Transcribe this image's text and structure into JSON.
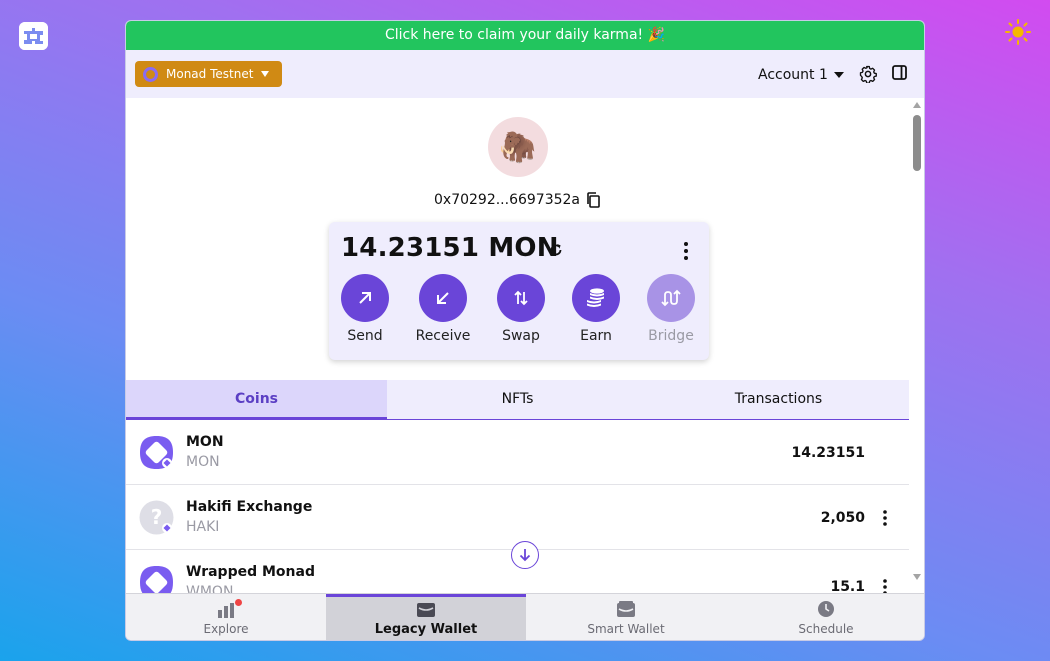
{
  "banner": {
    "text": "Click here to claim your daily karma! 🎉"
  },
  "topbar": {
    "network": "Monad Testnet",
    "account": "Account 1"
  },
  "profile": {
    "avatar_emoji": "🦣",
    "address": "0x70292...6697352a"
  },
  "balance": {
    "text": "14.23151 MON",
    "actions": [
      {
        "label": "Send",
        "icon": "arrow-up-right-icon",
        "enabled": true
      },
      {
        "label": "Receive",
        "icon": "arrow-down-left-icon",
        "enabled": true
      },
      {
        "label": "Swap",
        "icon": "swap-arrows-icon",
        "enabled": true
      },
      {
        "label": "Earn",
        "icon": "coins-stack-icon",
        "enabled": true
      },
      {
        "label": "Bridge",
        "icon": "bridge-icon",
        "enabled": false
      }
    ]
  },
  "tabs": [
    {
      "label": "Coins",
      "active": true
    },
    {
      "label": "NFTs",
      "active": false
    },
    {
      "label": "Transactions",
      "active": false
    }
  ],
  "coins": [
    {
      "name": "MON",
      "symbol": "MON",
      "balance": "14.23151",
      "icon": "monad-icon"
    },
    {
      "name": "Hakifi Exchange",
      "symbol": "HAKI",
      "balance": "2,050",
      "icon": "unknown-token-icon"
    },
    {
      "name": "Wrapped Monad",
      "symbol": "WMON",
      "balance": "15.1",
      "icon": "monad-icon"
    }
  ],
  "bottom_nav": [
    {
      "label": "Explore",
      "icon": "chart-bars-icon",
      "active": false,
      "notification": true
    },
    {
      "label": "Legacy Wallet",
      "icon": "wallet-icon",
      "active": true,
      "notification": false
    },
    {
      "label": "Smart Wallet",
      "icon": "smart-wallet-icon",
      "active": false,
      "notification": false
    },
    {
      "label": "Schedule",
      "icon": "clock-icon",
      "active": false,
      "notification": false
    }
  ],
  "colors": {
    "accent": "#6a45d8",
    "banner": "#22c55e",
    "network_badge": "#d08a14",
    "panel_bg": "#efedfd"
  }
}
